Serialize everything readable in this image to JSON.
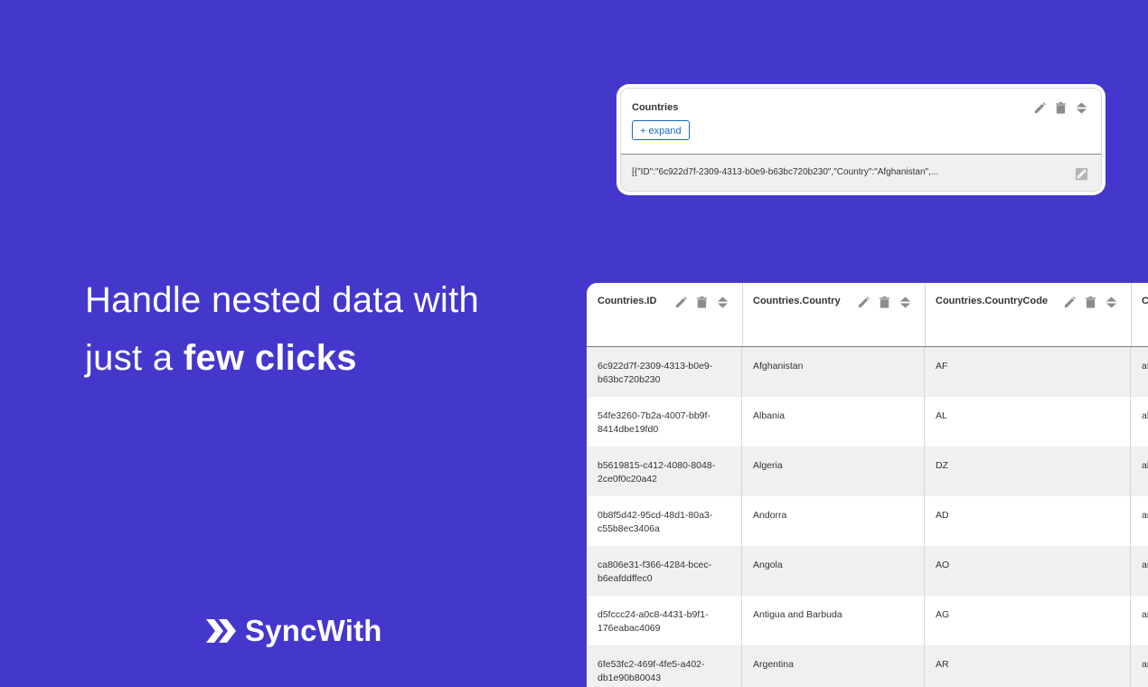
{
  "headline": {
    "line1": "Handle nested data with",
    "line2_prefix": "just a ",
    "line2_bold": "few clicks"
  },
  "brand": {
    "name": "SyncWith",
    "icon": "double-chevron-right-icon"
  },
  "card": {
    "title": "Countries",
    "expand_label": "+ expand",
    "value": "[{\"ID\":\"6c922d7f-2309-4313-b0e9-b63bc720b230\",\"Country\":\"Afghanistan\",..."
  },
  "table": {
    "columns": [
      "Countries.ID",
      "Countries.Country",
      "Countries.CountryCode",
      "C"
    ],
    "rows": [
      {
        "id": "6c922d7f-2309-4313-b0e9-b63bc720b230",
        "country": "Afghanistan",
        "code": "AF",
        "extra": "af"
      },
      {
        "id": "54fe3260-7b2a-4007-bb9f-8414dbe19fd0",
        "country": "Albania",
        "code": "AL",
        "extra": "al"
      },
      {
        "id": "b5619815-c412-4080-8048-2ce0f0c20a42",
        "country": "Algeria",
        "code": "DZ",
        "extra": "al"
      },
      {
        "id": "0b8f5d42-95cd-48d1-80a3-c55b8ec3406a",
        "country": "Andorra",
        "code": "AD",
        "extra": "an"
      },
      {
        "id": "ca806e31-f366-4284-bcec-b6eafddffec0",
        "country": "Angola",
        "code": "AO",
        "extra": "an"
      },
      {
        "id": "d5fccc24-a0c8-4431-b9f1-176eabac4069",
        "country": "Antigua and Barbuda",
        "code": "AG",
        "extra": "an"
      },
      {
        "id": "6fe53fc2-469f-4fe5-a402-db1e90b80043",
        "country": "Argentina",
        "code": "AR",
        "extra": "ar"
      }
    ]
  },
  "colors": {
    "background": "#4438cc",
    "accent": "#1a67c4"
  }
}
